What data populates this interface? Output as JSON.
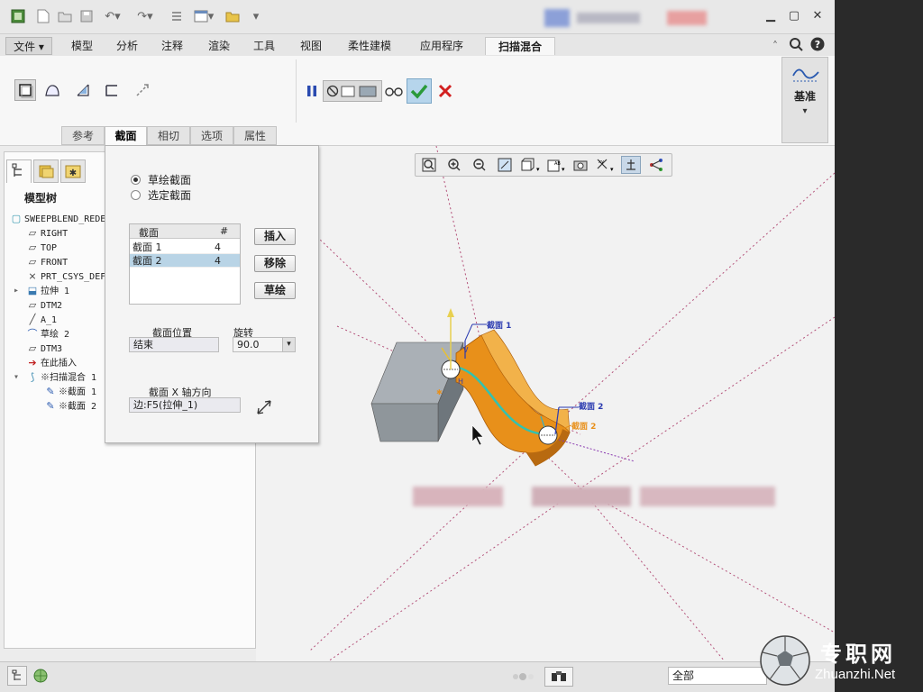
{
  "menu": {
    "file": "文件",
    "tabs": [
      "模型",
      "分析",
      "注释",
      "渲染",
      "工具",
      "视图",
      "柔性建模",
      "应用程序"
    ],
    "active_tab": "扫描混合"
  },
  "ribbon": {
    "subtabs": [
      "参考",
      "截面",
      "相切",
      "选项",
      "属性"
    ],
    "active_subtab": "截面",
    "datum_label": "基准"
  },
  "model_tree": {
    "header": "模型树",
    "items": [
      {
        "label": "SWEEPBLEND_REDE",
        "icon": "part-icon",
        "indent": 0
      },
      {
        "label": "RIGHT",
        "icon": "datum-plane-icon",
        "indent": 1
      },
      {
        "label": "TOP",
        "icon": "datum-plane-icon",
        "indent": 1
      },
      {
        "label": "FRONT",
        "icon": "datum-plane-icon",
        "indent": 1
      },
      {
        "label": "PRT_CSYS_DEF",
        "icon": "csys-icon",
        "indent": 1
      },
      {
        "label": "拉伸 1",
        "icon": "extrude-icon",
        "indent": 1
      },
      {
        "label": "DTM2",
        "icon": "datum-plane-icon",
        "indent": 1
      },
      {
        "label": "A_1",
        "icon": "axis-icon",
        "indent": 1
      },
      {
        "label": "草绘 2",
        "icon": "sketch-icon",
        "indent": 1
      },
      {
        "label": "DTM3",
        "icon": "datum-plane-icon",
        "indent": 1
      },
      {
        "label": "在此插入",
        "icon": "insert-here-icon",
        "indent": 1
      },
      {
        "label": "※扫描混合 1",
        "icon": "sweep-blend-icon",
        "indent": 1
      },
      {
        "label": "※截面 1",
        "icon": "section-icon",
        "indent": 2
      },
      {
        "label": "※截面 2",
        "icon": "section-icon",
        "indent": 2
      }
    ]
  },
  "section_panel": {
    "radio_sketched": "草绘截面",
    "radio_selected": "选定截面",
    "table_header_section": "截面",
    "table_header_count": "#",
    "rows": [
      {
        "name": "截面 1",
        "count": "4"
      },
      {
        "name": "截面 2",
        "count": "4"
      }
    ],
    "insert_button": "插入",
    "remove_button": "移除",
    "sketch_button": "草绘",
    "position_label": "截面位置",
    "position_value": "结束",
    "rotation_label": "旋转",
    "rotation_value": "90.0",
    "x_axis_label": "截面 X 轴方向",
    "x_axis_value": "边:F5(拉伸_1)"
  },
  "viewport_labels": {
    "section_tag_1": "截面 1",
    "section_tag_2": "截面 2",
    "orange_tag_2": "截面 2"
  },
  "status": {
    "filter": "全部"
  },
  "watermark": {
    "cn": "专职网",
    "url": "Zhuanzhi.Net"
  },
  "colors": {
    "accent_orange": "#e8901a",
    "teal_path": "#32c2b0",
    "block_gray": "#8f969b",
    "datum_line": "#b4527a",
    "ok_green": "#2a9a3a",
    "cancel_red": "#d22020"
  }
}
